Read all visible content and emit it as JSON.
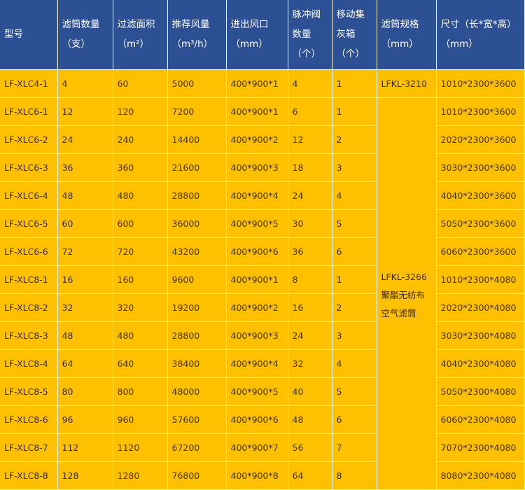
{
  "header": {
    "columns": [
      {
        "lines": [
          "型号"
        ]
      },
      {
        "lines": [
          "滤筒数量",
          "（支）"
        ]
      },
      {
        "lines": [
          "过滤面积",
          "（m²）"
        ]
      },
      {
        "lines": [
          "推荐风量",
          "（m³/h）"
        ]
      },
      {
        "lines": [
          "进出风口",
          "（mm）"
        ]
      },
      {
        "lines": [
          "脉冲阀",
          "数量",
          "（个）"
        ]
      },
      {
        "lines": [
          "移动集",
          "灰箱",
          "（个）"
        ]
      },
      {
        "lines": [
          "滤筒规格",
          "（mm）"
        ]
      },
      {
        "lines": [
          "尺寸（长*宽*高）",
          "（mm）"
        ]
      }
    ]
  },
  "spec_first": "LFKL-3210",
  "spec_merged": [
    "LFKL-3266",
    "聚酯无纺布",
    "空气滤筒"
  ],
  "rows": [
    {
      "model": "LF-XLC4-1",
      "cartridges": "4",
      "area": "60",
      "airflow": "5000",
      "inlet": "400*900*1",
      "valves": "4",
      "boxes": "1",
      "size": "1010*2300*3600"
    },
    {
      "model": "LF-XLC6-1",
      "cartridges": "12",
      "area": "120",
      "airflow": "7200",
      "inlet": "400*900*1",
      "valves": "6",
      "boxes": "1",
      "size": "1010*2300*3600"
    },
    {
      "model": "LF-XLC6-2",
      "cartridges": "24",
      "area": "240",
      "airflow": "14400",
      "inlet": "400*900*2",
      "valves": "12",
      "boxes": "2",
      "size": "2020*2300*3600"
    },
    {
      "model": "LF-XLC6-3",
      "cartridges": "36",
      "area": "360",
      "airflow": "21600",
      "inlet": "400*900*3",
      "valves": "18",
      "boxes": "3",
      "size": "3030*2300*3600"
    },
    {
      "model": "LF-XLC6-4",
      "cartridges": "48",
      "area": "480",
      "airflow": "28800",
      "inlet": "400*900*4",
      "valves": "24",
      "boxes": "4",
      "size": "4040*2300*3600"
    },
    {
      "model": "LF-XLC6-5",
      "cartridges": "60",
      "area": "600",
      "airflow": "36000",
      "inlet": "400*900*5",
      "valves": "30",
      "boxes": "5",
      "size": "5050*2300*3600"
    },
    {
      "model": "LF-XLC6-6",
      "cartridges": "72",
      "area": "720",
      "airflow": "43200",
      "inlet": "400*900*6",
      "valves": "36",
      "boxes": "6",
      "size": "6060*2300*3600"
    },
    {
      "model": "LF-XLC8-1",
      "cartridges": "16",
      "area": "160",
      "airflow": "9600",
      "inlet": "400*900*1",
      "valves": "8",
      "boxes": "1",
      "size": "1010*2300*4080"
    },
    {
      "model": "LF-XLC8-2",
      "cartridges": "32",
      "area": "320",
      "airflow": "19200",
      "inlet": "400*900*2",
      "valves": "16",
      "boxes": "2",
      "size": "2020*2300*4080"
    },
    {
      "model": "LF-XLC8-3",
      "cartridges": "48",
      "area": "480",
      "airflow": "28800",
      "inlet": "400*900*3",
      "valves": "24",
      "boxes": "3",
      "size": "3030*2300*4080"
    },
    {
      "model": "LF-XLC8-4",
      "cartridges": "64",
      "area": "640",
      "airflow": "38400",
      "inlet": "400*900*4",
      "valves": "32",
      "boxes": "4",
      "size": "4040*2300*4080"
    },
    {
      "model": "LF-XLC8-5",
      "cartridges": "80",
      "area": "800",
      "airflow": "48000",
      "inlet": "400*900*5",
      "valves": "40",
      "boxes": "5",
      "size": "5050*2300*4080"
    },
    {
      "model": "LF-XLC8-6",
      "cartridges": "96",
      "area": "960",
      "airflow": "57600",
      "inlet": "400*900*6",
      "valves": "48",
      "boxes": "6",
      "size": "6060*2300*4080"
    },
    {
      "model": "LF-XLC8-7",
      "cartridges": "112",
      "area": "1120",
      "airflow": "67200",
      "inlet": "400*900*7",
      "valves": "56",
      "boxes": "7",
      "size": "7070*2300*4080"
    },
    {
      "model": "LF-XLC8-8",
      "cartridges": "128",
      "area": "1280",
      "airflow": "76800",
      "inlet": "400*900*8",
      "valves": "64",
      "boxes": "8",
      "size": "8080*2300*4080"
    }
  ],
  "colors": {
    "header_bg": "#2d4f94",
    "cell_bg": "#ffc000",
    "grid": "#ffffff"
  }
}
